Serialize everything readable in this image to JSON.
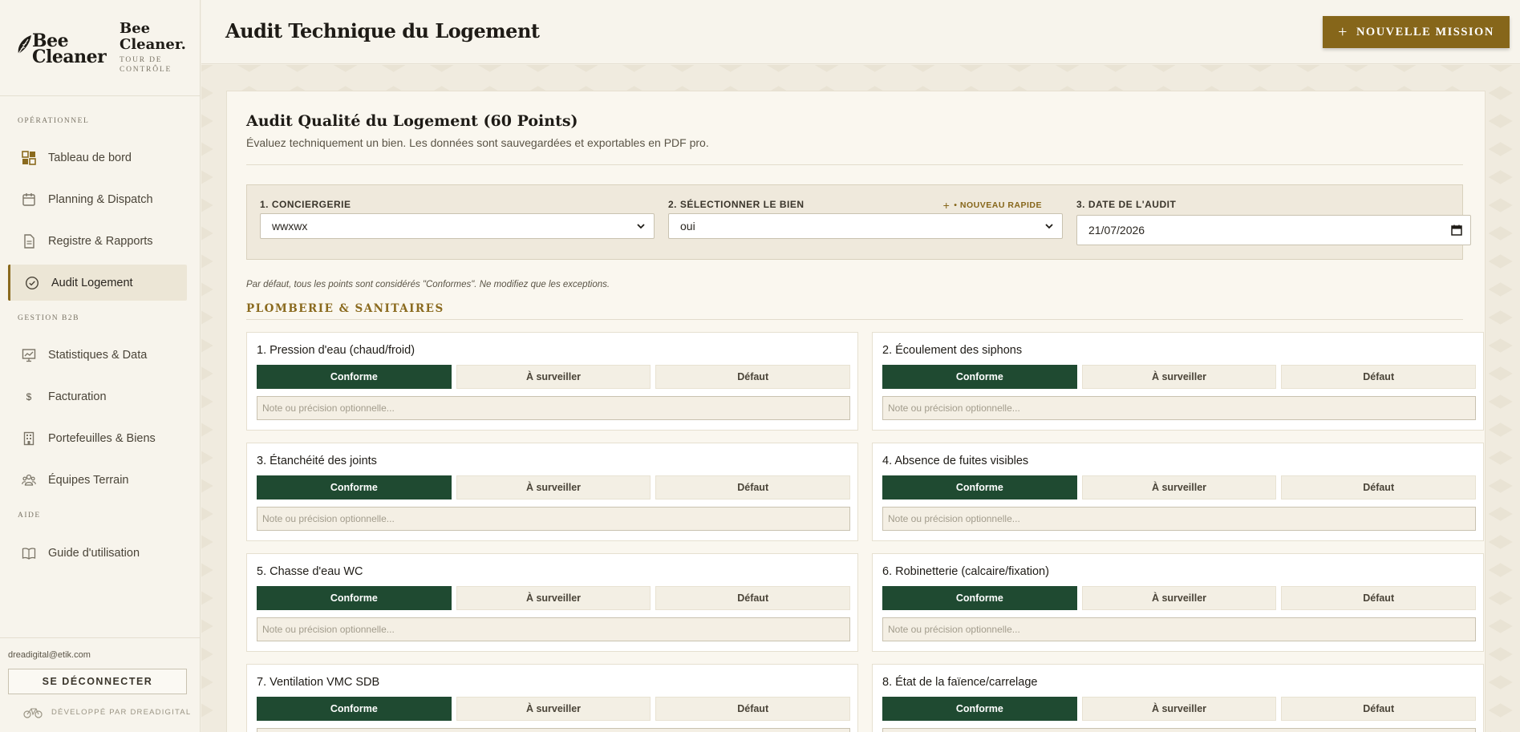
{
  "brand": {
    "logo_line1": "Bee",
    "logo_line2": "Cleaner",
    "title": "Bee Cleaner.",
    "subtitle": "Tour de contrôle"
  },
  "sidebar": {
    "sections": [
      {
        "label": "Opérationnel"
      },
      {
        "label": "Gestion B2B"
      },
      {
        "label": "Aide"
      }
    ],
    "items": [
      {
        "label": "Tableau de bord",
        "icon": "dashboard-icon"
      },
      {
        "label": "Planning & Dispatch",
        "icon": "calendar-icon"
      },
      {
        "label": "Registre & Rapports",
        "icon": "document-icon"
      },
      {
        "label": "Audit Logement",
        "icon": "check-circle-icon",
        "active": true
      },
      {
        "label": "Statistiques & Data",
        "icon": "chart-icon"
      },
      {
        "label": "Facturation",
        "icon": "dollar-icon"
      },
      {
        "label": "Portefeuilles & Biens",
        "icon": "building-icon"
      },
      {
        "label": "Équipes Terrain",
        "icon": "team-icon"
      },
      {
        "label": "Guide d'utilisation",
        "icon": "book-icon"
      }
    ],
    "user_email": "dreadigital@etik.com",
    "logout_label": "Se déconnecter",
    "dev_by": "Développé par DreaDigital"
  },
  "header": {
    "title": "Audit Technique du Logement",
    "new_mission_label": "Nouvelle mission"
  },
  "audit": {
    "title": "Audit Qualité du Logement (60 Points)",
    "subtitle": "Évaluez techniquement un bien. Les données sont sauvegardées et exportables en PDF pro.",
    "conciergerie_label": "1. Conciergerie",
    "conciergerie_value": "wwxwx",
    "bien_label": "2. Sélectionner le bien",
    "bien_value": "oui",
    "quick_new_label": "• Nouveau rapide",
    "date_label": "3. Date de l'audit",
    "date_value": "21/07/2026",
    "hint": "Par défaut, tous les points sont considérés \"Conformes\". Ne modifiez que les exceptions.",
    "section_title": "Plomberie & Sanitaires",
    "option_labels": {
      "ok": "Conforme",
      "watch": "À surveiller",
      "fail": "Défaut"
    },
    "note_placeholder": "Note ou précision optionnelle...",
    "points": [
      {
        "title": "1. Pression d'eau (chaud/froid)",
        "status": "Conforme"
      },
      {
        "title": "2. Écoulement des siphons",
        "status": "Conforme"
      },
      {
        "title": "3. Étanchéité des joints",
        "status": "Conforme"
      },
      {
        "title": "4. Absence de fuites visibles",
        "status": "Conforme"
      },
      {
        "title": "5. Chasse d'eau WC",
        "status": "Conforme"
      },
      {
        "title": "6. Robinetterie (calcaire/fixation)",
        "status": "Conforme"
      },
      {
        "title": "7. Ventilation VMC SDB",
        "status": "Conforme"
      },
      {
        "title": "8. État de la faïence/carrelage",
        "status": "Conforme"
      }
    ]
  },
  "colors": {
    "accent_gold": "#86661a",
    "conforme_green": "#1f4a31",
    "background": "#f3efe4"
  }
}
